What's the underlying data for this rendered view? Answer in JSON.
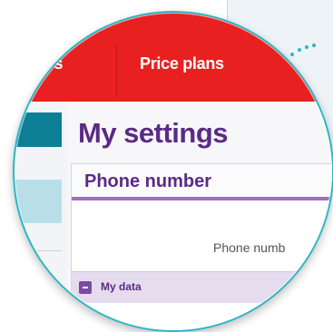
{
  "nav": {
    "left_label": "es",
    "right_label": "Price plans"
  },
  "page": {
    "title": "My settings"
  },
  "card": {
    "title": "Phone number",
    "field_label": "Phone numb",
    "section_label": "My data"
  },
  "colors": {
    "brand_red": "#e8201f",
    "purple": "#5b2a86",
    "teal": "#0d7f95",
    "lens_ring": "#2ab7c6"
  },
  "icons": {
    "collapse": "minus-icon"
  }
}
